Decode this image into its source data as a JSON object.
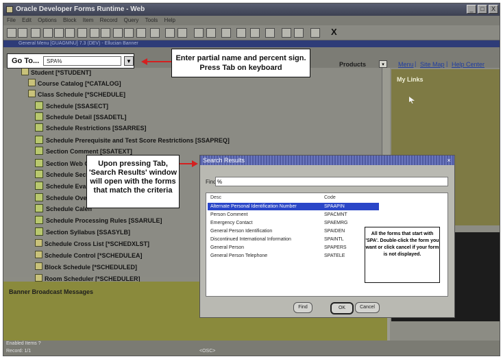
{
  "window": {
    "title": "Oracle Developer Forms Runtime - Web",
    "controls": [
      "_",
      "□",
      "X"
    ]
  },
  "menu": [
    "File",
    "Edit",
    "Options",
    "Block",
    "Item",
    "Record",
    "Query",
    "Tools",
    "Help"
  ],
  "toolbar": {
    "exit_label": "X"
  },
  "banner": {
    "text": "General Menu [GUAGMNU] 7.3 (DEV) - Ellucian Banner"
  },
  "header": {
    "products_label": "Products",
    "menu_link": "Menu",
    "sitemap_link": "Site Map",
    "help_link": "Help Center"
  },
  "goto": {
    "label": "Go To...",
    "value": "SPA%"
  },
  "callouts": {
    "partial_name": "Enter partial name and percent sign. Press Tab on keyboard",
    "upon_tab": "Upon pressing Tab, 'Search Results' window will open with the forms that match the criteria"
  },
  "tree": {
    "root": "Student [*STUDENT]",
    "nodes": [
      {
        "label": "Course Catalog [*CATALOG]",
        "kind": "folder"
      },
      {
        "label": "Class Schedule [*SCHEDULE]",
        "kind": "folder"
      },
      {
        "label": "Schedule [SSASECT]",
        "kind": "form"
      },
      {
        "label": "Schedule Detail [SSADETL]",
        "kind": "form"
      },
      {
        "label": "Schedule Restrictions [SSARRES]",
        "kind": "form"
      },
      {
        "label": "Schedule Prerequisite and Test Score Restrictions [SSAPREQ]",
        "kind": "form"
      },
      {
        "label": "Section Comment [SSATEXT]",
        "kind": "form"
      },
      {
        "label": "Section Web C",
        "kind": "form"
      },
      {
        "label": "Schedule Secti",
        "kind": "form"
      },
      {
        "label": "Schedule Evalu",
        "kind": "form"
      },
      {
        "label": "Schedule Over",
        "kind": "form"
      },
      {
        "label": "Schedule Calen",
        "kind": "form"
      },
      {
        "label": "Schedule Processing Rules [SSARULE]",
        "kind": "form"
      },
      {
        "label": "Section Syllabus [SSASYLB]",
        "kind": "form"
      },
      {
        "label": "Schedule Cross List [*SCHEDXLST]",
        "kind": "folder"
      },
      {
        "label": "Schedule Control [*SCHEDULEA]",
        "kind": "folder"
      },
      {
        "label": "Block Schedule [*SCHEDULED]",
        "kind": "folder"
      },
      {
        "label": "Room Scheduler [*SCHEDULER]",
        "kind": "folder"
      }
    ]
  },
  "right_panel": {
    "title": "My Links"
  },
  "broadcast": {
    "title": "Banner Broadcast Messages"
  },
  "status": {
    "line1": "Enabled Items ?",
    "line2": "Record: 1/1",
    "osc": "<OSC>"
  },
  "dialog": {
    "title": "Search Results",
    "find_label": "Find",
    "find_value": "%",
    "col_desc": "Desc",
    "col_code": "Code",
    "rows": [
      {
        "desc": "Alternate Personal Identification Number",
        "code": "SPAAPIN"
      },
      {
        "desc": "Person Comment",
        "code": "SPACMNT"
      },
      {
        "desc": "Emergency Contact",
        "code": "SPAEMRG"
      },
      {
        "desc": "General Person Identification",
        "code": "SPAIDEN"
      },
      {
        "desc": "Discontinued International Information",
        "code": "SPAINTL"
      },
      {
        "desc": "General Person",
        "code": "SPAPERS"
      },
      {
        "desc": "General Person Telephone",
        "code": "SPATELE"
      }
    ],
    "note": "All the forms that start with 'SPA'. Double-click the form you want or click cancel if your form is not displayed.",
    "find_button": "Find",
    "ok_button": "OK",
    "cancel_button": "Cancel"
  }
}
